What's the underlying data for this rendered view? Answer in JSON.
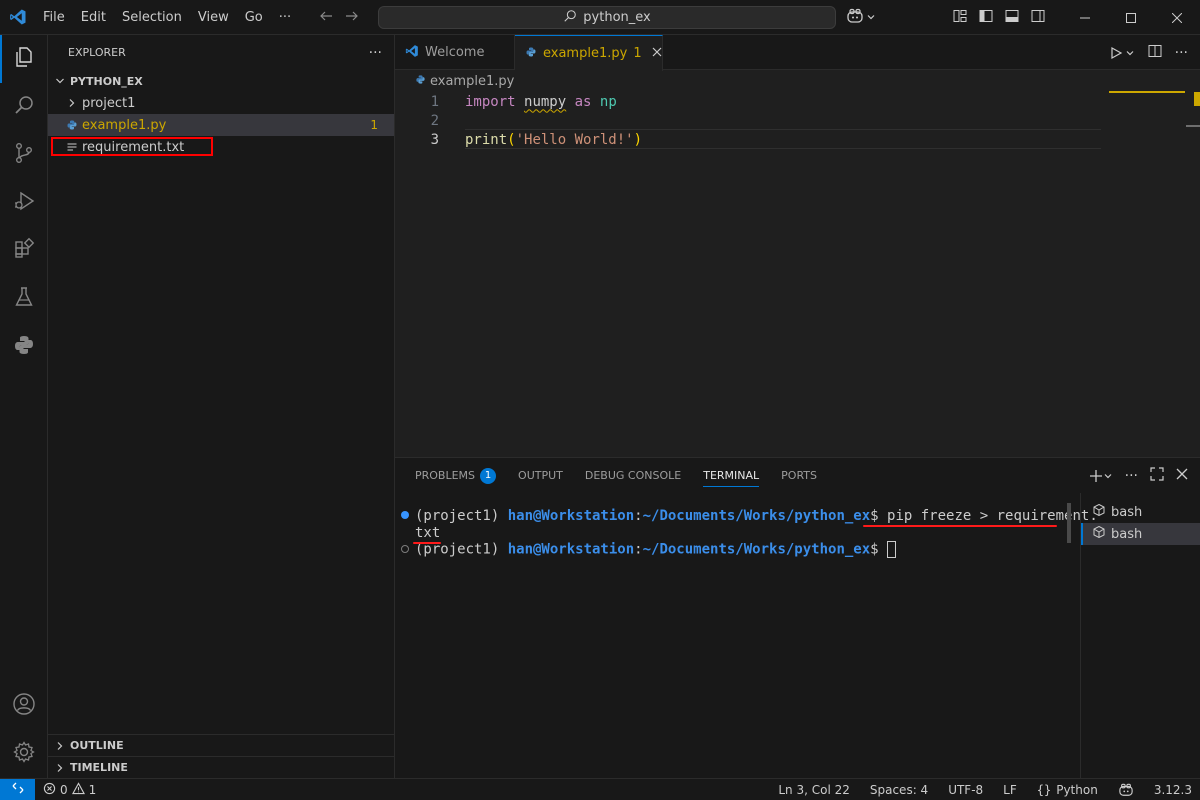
{
  "titlebar": {
    "menu": [
      "File",
      "Edit",
      "Selection",
      "View",
      "Go",
      "···"
    ],
    "command_center": "python_ex"
  },
  "sidebar": {
    "title": "EXPLORER",
    "more": "···",
    "root": "PYTHON_EX",
    "items": [
      {
        "label": "project1",
        "type": "folder"
      },
      {
        "label": "example1.py",
        "type": "python",
        "badge": "1"
      },
      {
        "label": "requirement.txt",
        "type": "text"
      }
    ],
    "outline": "OUTLINE",
    "timeline": "TIMELINE"
  },
  "editor": {
    "tabs": [
      {
        "label": "Welcome"
      },
      {
        "label": "example1.py",
        "badge": "1"
      }
    ],
    "breadcrumb": "example1.py",
    "lines": [
      {
        "num": "1",
        "tokens": [
          "import",
          " ",
          "numpy",
          " ",
          "as",
          " ",
          "np"
        ]
      },
      {
        "num": "2"
      },
      {
        "num": "3",
        "tokens": [
          "print",
          "(",
          "'Hello World!'",
          ")"
        ]
      }
    ]
  },
  "panel": {
    "tabs": [
      "PROBLEMS",
      "OUTPUT",
      "DEBUG CONSOLE",
      "TERMINAL",
      "PORTS"
    ],
    "problems_badge": "1",
    "terminal": {
      "env": "(project1) ",
      "userhost": "han@Workstation",
      "colon": ":",
      "path": "~/Documents/Works/python_ex",
      "prompt": "$ ",
      "command_part1": "pip freeze > requirement.",
      "command_part2": "txt"
    },
    "terminals": [
      "bash",
      "bash"
    ]
  },
  "statusbar": {
    "errors": "0",
    "warnings": "1",
    "position": "Ln 3, Col 22",
    "spaces": "Spaces: 4",
    "encoding": "UTF-8",
    "eol": "LF",
    "language": "Python",
    "version": "3.12.3"
  },
  "colors": {
    "accent": "#0078d4",
    "warning": "#cca700",
    "highlight_red": "#ff0000"
  }
}
